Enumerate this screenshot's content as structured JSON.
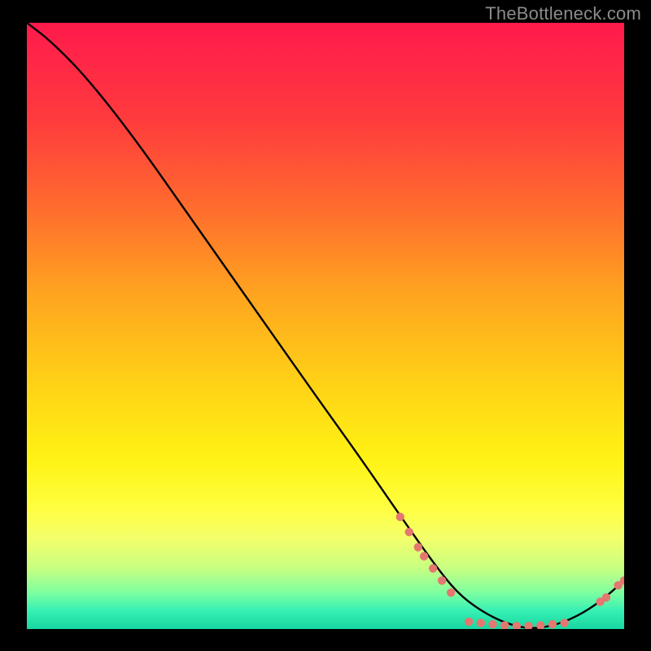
{
  "attribution": "TheBottleneck.com",
  "chart_data": {
    "type": "line",
    "title": "",
    "xlabel": "",
    "ylabel": "",
    "xlim": [
      0,
      100
    ],
    "ylim": [
      0,
      100
    ],
    "curve": {
      "x": [
        0,
        4,
        10,
        18,
        28,
        38,
        48,
        56,
        63,
        68,
        72,
        76,
        80,
        84,
        88,
        92,
        96,
        100
      ],
      "y": [
        100,
        97,
        91,
        81,
        67,
        53,
        39,
        28,
        18,
        11,
        6,
        3,
        1,
        0,
        0.5,
        2,
        4.5,
        8
      ]
    },
    "markers": [
      {
        "x": 62.5,
        "y": 18.5
      },
      {
        "x": 64.0,
        "y": 16.0
      },
      {
        "x": 65.5,
        "y": 13.5
      },
      {
        "x": 66.5,
        "y": 12.0
      },
      {
        "x": 68.0,
        "y": 10.0
      },
      {
        "x": 69.5,
        "y": 8.0
      },
      {
        "x": 71.0,
        "y": 6.0
      },
      {
        "x": 74.0,
        "y": 1.2
      },
      {
        "x": 76.0,
        "y": 1.0
      },
      {
        "x": 78.0,
        "y": 0.8
      },
      {
        "x": 80.0,
        "y": 0.6
      },
      {
        "x": 82.0,
        "y": 0.5
      },
      {
        "x": 84.0,
        "y": 0.5
      },
      {
        "x": 86.0,
        "y": 0.6
      },
      {
        "x": 88.0,
        "y": 0.8
      },
      {
        "x": 90.0,
        "y": 1.0
      },
      {
        "x": 96.0,
        "y": 4.5
      },
      {
        "x": 97.0,
        "y": 5.2
      },
      {
        "x": 99.0,
        "y": 7.2
      },
      {
        "x": 100.0,
        "y": 8.0
      }
    ],
    "gradient_stops": [
      {
        "offset": 0,
        "color": "#ff1a4d"
      },
      {
        "offset": 16,
        "color": "#ff3b3d"
      },
      {
        "offset": 30,
        "color": "#ff6a2e"
      },
      {
        "offset": 45,
        "color": "#ffa51f"
      },
      {
        "offset": 60,
        "color": "#ffd316"
      },
      {
        "offset": 72,
        "color": "#fff314"
      },
      {
        "offset": 80,
        "color": "#ffff40"
      },
      {
        "offset": 85,
        "color": "#f4ff6a"
      },
      {
        "offset": 90,
        "color": "#c7ff82"
      },
      {
        "offset": 94,
        "color": "#7effa0"
      },
      {
        "offset": 97,
        "color": "#36f0b4"
      },
      {
        "offset": 100,
        "color": "#18d6a0"
      }
    ]
  }
}
